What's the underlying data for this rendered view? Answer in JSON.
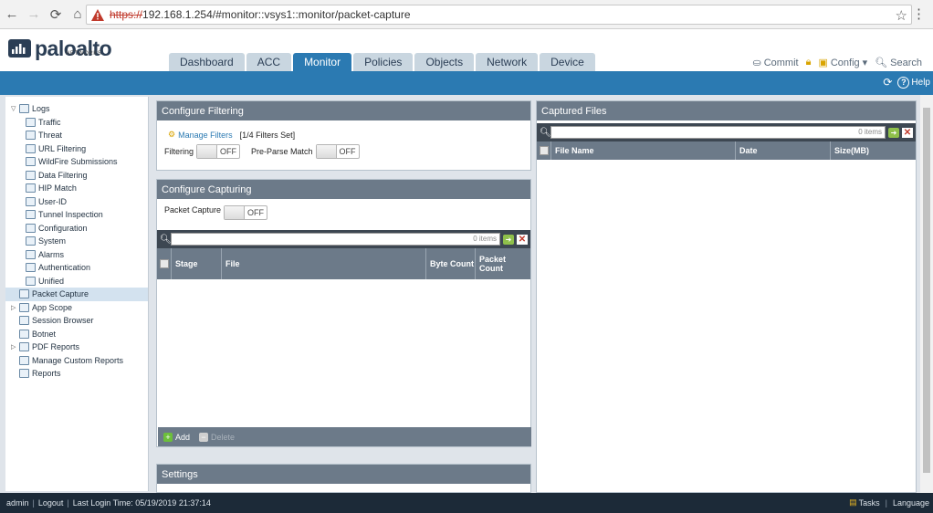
{
  "browser": {
    "url_scheme": "https://",
    "url_rest": "192.168.1.254/#monitor::vsys1::monitor/packet-capture"
  },
  "header": {
    "brand": "paloalto",
    "brand_sub": "NETWORKS",
    "tabs": [
      "Dashboard",
      "ACC",
      "Monitor",
      "Policies",
      "Objects",
      "Network",
      "Device"
    ],
    "active_tab": "Monitor",
    "commit_label": "Commit",
    "config_label": "Config",
    "search_label": "Search",
    "help_label": "Help"
  },
  "sidebar": {
    "items": [
      {
        "label": "Logs",
        "level": "top",
        "expand": "▽"
      },
      {
        "label": "Traffic",
        "level": "child"
      },
      {
        "label": "Threat",
        "level": "child"
      },
      {
        "label": "URL Filtering",
        "level": "child"
      },
      {
        "label": "WildFire Submissions",
        "level": "child"
      },
      {
        "label": "Data Filtering",
        "level": "child"
      },
      {
        "label": "HIP Match",
        "level": "child"
      },
      {
        "label": "User-ID",
        "level": "child"
      },
      {
        "label": "Tunnel Inspection",
        "level": "child"
      },
      {
        "label": "Configuration",
        "level": "child"
      },
      {
        "label": "System",
        "level": "child"
      },
      {
        "label": "Alarms",
        "level": "child"
      },
      {
        "label": "Authentication",
        "level": "child"
      },
      {
        "label": "Unified",
        "level": "child"
      },
      {
        "label": "Packet Capture",
        "level": "top-noexp",
        "selected": true
      },
      {
        "label": "App Scope",
        "level": "top",
        "expand": "▷"
      },
      {
        "label": "Session Browser",
        "level": "top-noexp"
      },
      {
        "label": "Botnet",
        "level": "top-noexp"
      },
      {
        "label": "PDF Reports",
        "level": "top",
        "expand": "▷"
      },
      {
        "label": "Manage Custom Reports",
        "level": "top-noexp"
      },
      {
        "label": "Reports",
        "level": "top-noexp"
      }
    ]
  },
  "filtering": {
    "title": "Configure Filtering",
    "manage_filters": "Manage Filters",
    "filters_set": "[1/4 Filters Set]",
    "filtering_label": "Filtering",
    "filtering_state": "OFF",
    "preparse_label": "Pre-Parse Match",
    "preparse_state": "OFF"
  },
  "capturing": {
    "title": "Configure Capturing",
    "packet_capture_label": "Packet Capture",
    "packet_capture_state": "OFF",
    "items_count": "0 items",
    "columns": [
      "Stage",
      "File",
      "Byte Count",
      "Packet Count"
    ],
    "add_label": "Add",
    "delete_label": "Delete"
  },
  "settings": {
    "title": "Settings"
  },
  "captured_files": {
    "title": "Captured Files",
    "items_count": "0 items",
    "columns": [
      "File Name",
      "Date",
      "Size(MB)"
    ]
  },
  "status": {
    "user": "admin",
    "logout": "Logout",
    "last_login": "Last Login Time: 05/19/2019 21:37:14",
    "tasks": "Tasks",
    "language": "Language"
  }
}
